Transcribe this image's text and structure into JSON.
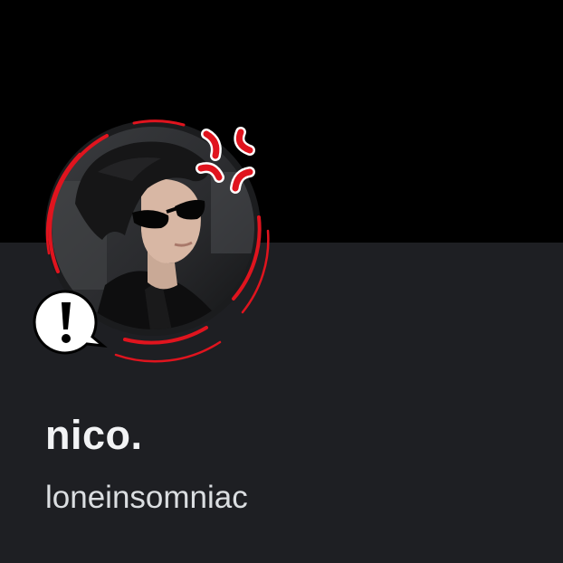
{
  "profile": {
    "display_name": "nico.",
    "username": "loneinsomniac",
    "avatar": {
      "decoration": "anger-symbol-icon",
      "badge": "exclamation-speech-bubble-icon"
    }
  },
  "colors": {
    "banner": "#000000",
    "card_background": "#1e1f23",
    "display_name_text": "#f2f3f5",
    "username_text": "#dbdee1",
    "decoration_red": "#e0141e"
  }
}
